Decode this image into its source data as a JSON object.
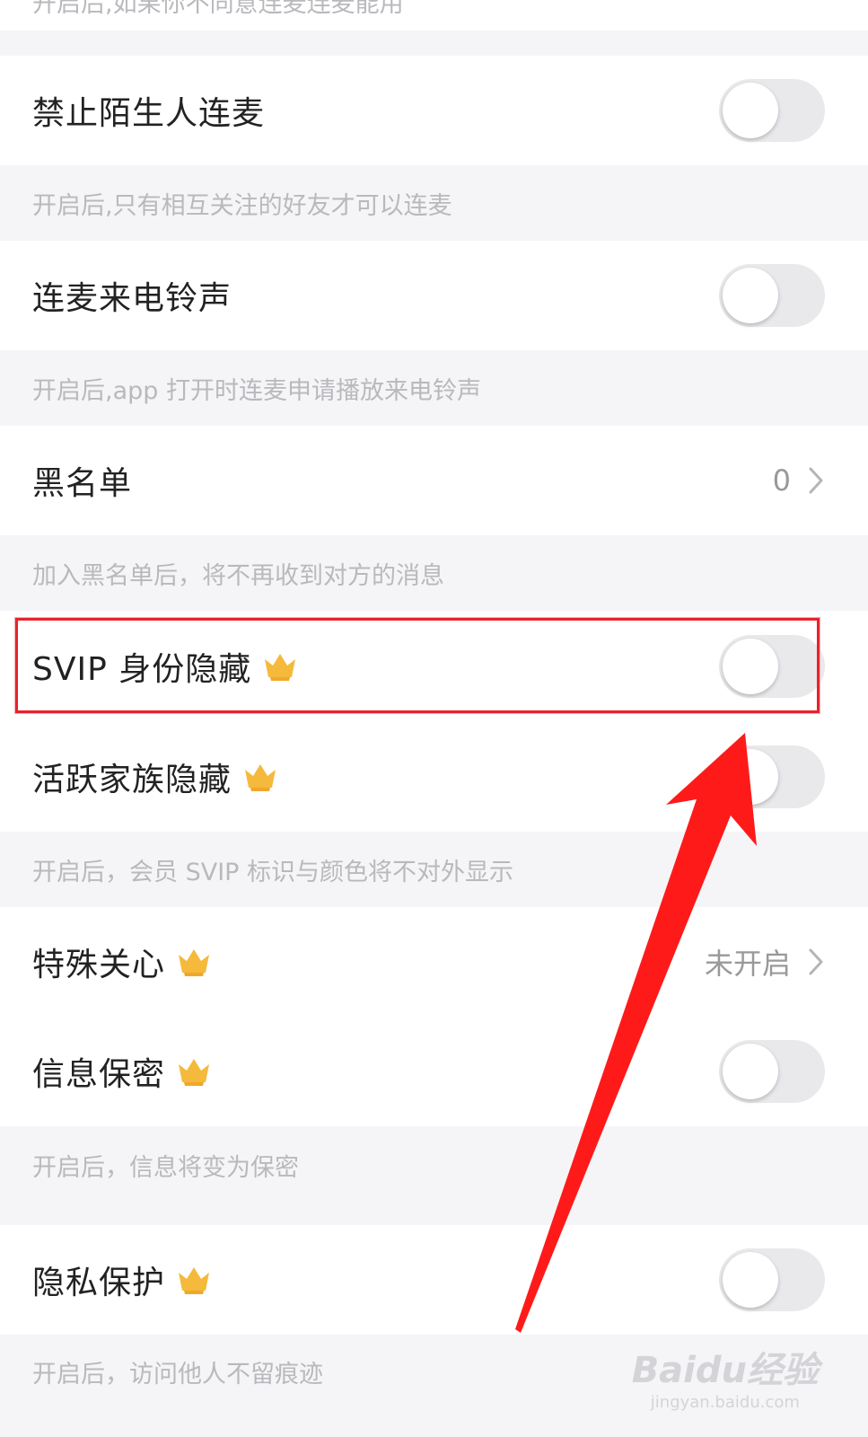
{
  "top_partial_note": "开启后,如果你不同意连麦连麦能用",
  "settings": [
    {
      "label": "禁止陌生人连麦",
      "note": "开启后,只有相互关注的好友才可以连麦"
    },
    {
      "label": "连麦来电铃声",
      "note": "开启后,app 打开时连麦申请播放来电铃声"
    },
    {
      "label": "黑名单",
      "value": "0",
      "note": "加入黑名单后，将不再收到对方的消息"
    },
    {
      "label": "SVIP 身份隐藏"
    },
    {
      "label": "活跃家族隐藏",
      "note": "开启后，会员 SVIP 标识与颜色将不对外显示"
    },
    {
      "label": "特殊关心",
      "value": "未开启"
    },
    {
      "label": "信息保密",
      "note": "开启后，信息将变为保密"
    },
    {
      "label": "隐私保护",
      "note": "开启后，访问他人不留痕迹"
    }
  ],
  "watermark": {
    "main": "Baidu经验",
    "sub": "jingyan.baidu.com"
  },
  "colors": {
    "highlight": "#e8232b",
    "arrow": "#ff1a1a",
    "crown": "#f5b93b"
  }
}
